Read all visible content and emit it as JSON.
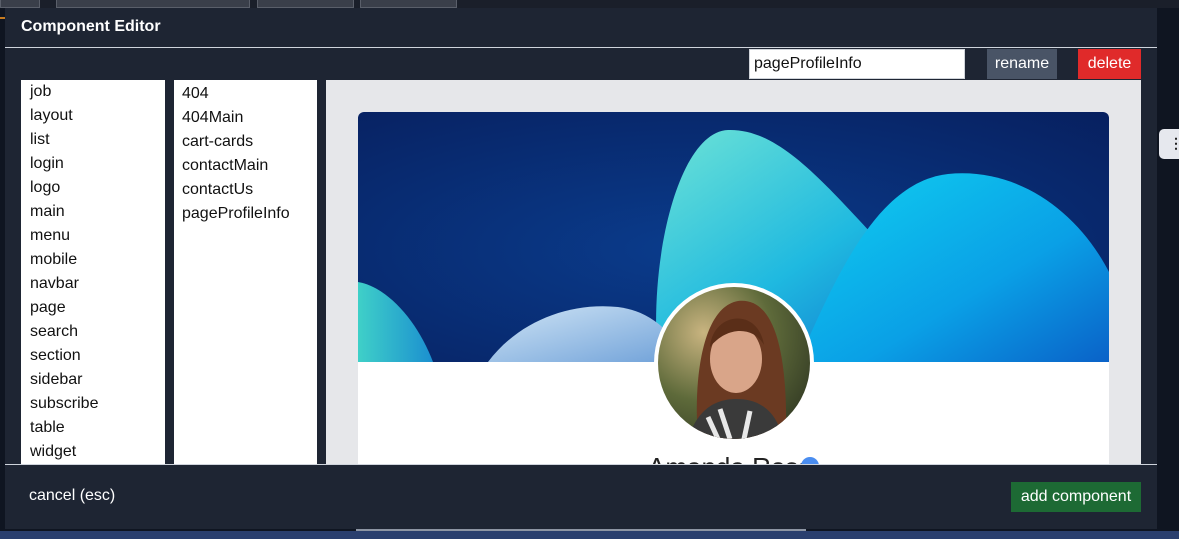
{
  "modal": {
    "title": "Component Editor"
  },
  "editor": {
    "component_name_value": "pageProfileInfo",
    "rename_label": "rename",
    "delete_label": "delete"
  },
  "categories": [
    "job",
    "layout",
    "list",
    "login",
    "logo",
    "main",
    "menu",
    "mobile",
    "navbar",
    "page",
    "search",
    "section",
    "sidebar",
    "subscribe",
    "table",
    "widget"
  ],
  "components": [
    "404",
    "404Main",
    "cart-cards",
    "contactMain",
    "contactUs",
    "pageProfileInfo"
  ],
  "preview": {
    "profile_name": "Amanda Ross"
  },
  "footer": {
    "cancel_label": "cancel (esc)",
    "add_label": "add component"
  },
  "colors": {
    "modal_bg": "#1e2533",
    "rename_bg": "#495466",
    "delete_bg": "#e02a2a",
    "add_bg": "#1d6a34",
    "verified": "#4a8df0"
  },
  "icons": {
    "verified": "verified-badge-icon",
    "background_menu": "vertical-dots-icon"
  }
}
